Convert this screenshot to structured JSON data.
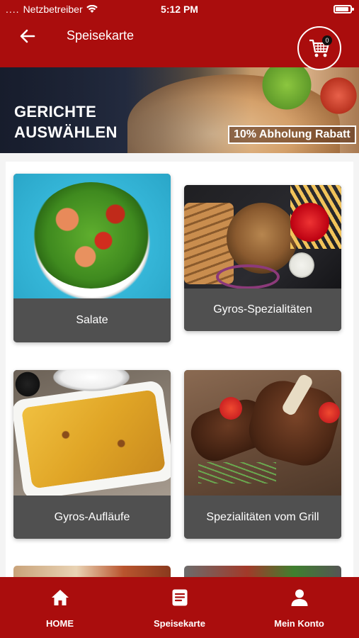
{
  "status_bar": {
    "carrier": "Netzbetreiber",
    "time": "5:12 PM"
  },
  "header": {
    "title": "Speisekarte",
    "cart_count": "0"
  },
  "banner": {
    "title": "GERICHTE AUSWÄHLEN",
    "badge": "10% Abholung Rabatt"
  },
  "categories": [
    {
      "label": "Salate"
    },
    {
      "label": "Gyros-Spezialitäten"
    },
    {
      "label": "Gyros-Aufläufe"
    },
    {
      "label": "Spezialitäten vom Grill"
    }
  ],
  "bottom_nav": [
    {
      "label": "HOME",
      "icon": "home-icon"
    },
    {
      "label": "Speisekarte",
      "icon": "menu-icon"
    },
    {
      "label": "Mein Konto",
      "icon": "user-icon"
    }
  ],
  "colors": {
    "brand": "#aa0d0d",
    "card_label_bg": "#505050"
  }
}
